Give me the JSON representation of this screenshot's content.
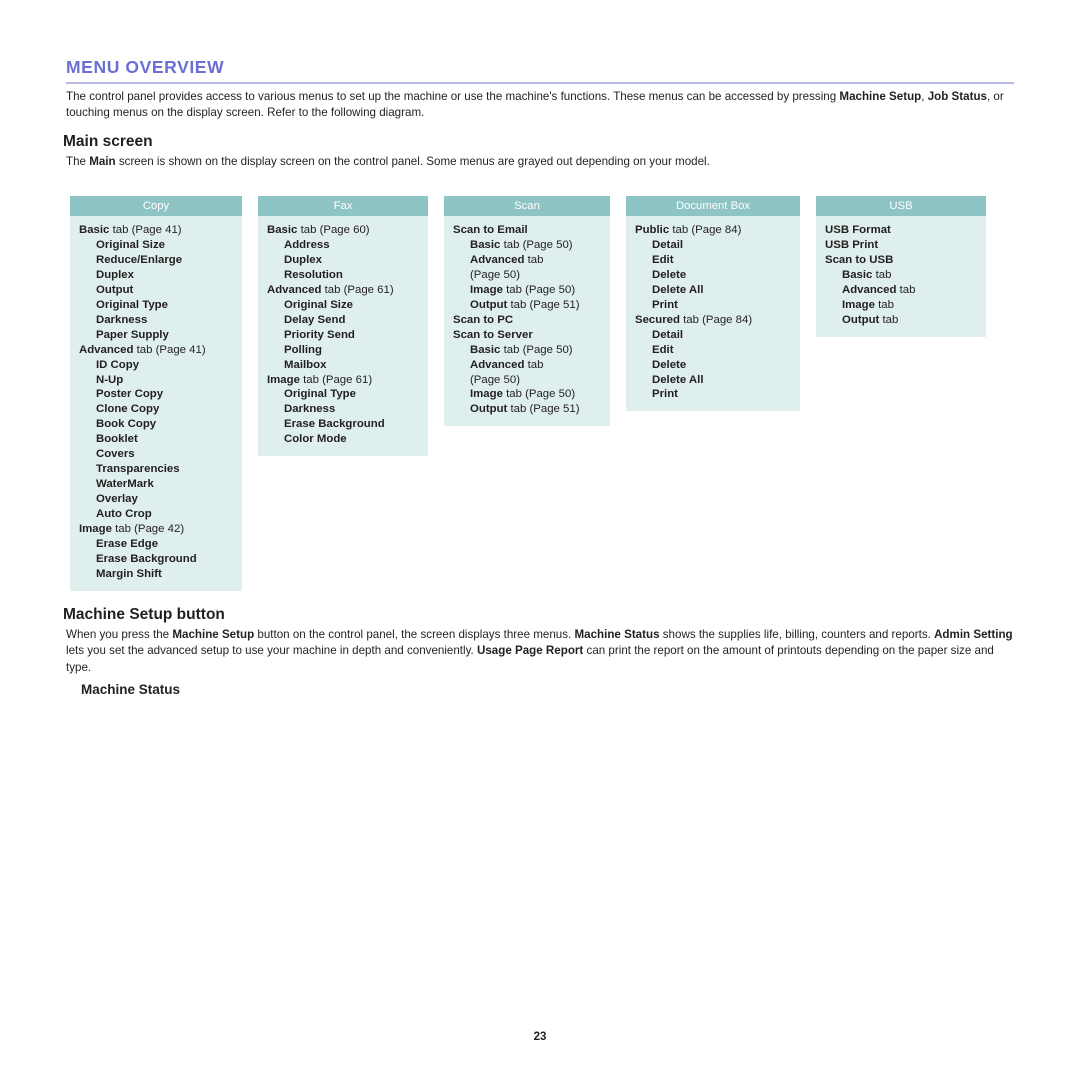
{
  "document": {
    "title": "MENU OVERVIEW",
    "page_number": "23",
    "accent_color": "#6b6fd4",
    "rule_color": "#b9bce8",
    "diagram_header_color": "#8ec4c4",
    "diagram_body_color": "#dfefee"
  },
  "intro_paragraph": {
    "full_text": "The control panel provides access to various menus to set up the machine or use the machine's functions. These menus can be accessed by pressing Machine Setup, Job Status, or touching menus on the display screen. Refer to the following diagram.",
    "segments": [
      {
        "text": "The control panel provides access to various menus to set up the machine or use the machine's functions. These menus can be accessed by pressing ",
        "bold": false
      },
      {
        "text": "Machine Setup",
        "bold": true
      },
      {
        "text": ", ",
        "bold": false
      },
      {
        "text": "Job Status",
        "bold": true
      },
      {
        "text": ", or touching menus on the display screen. Refer to the following diagram.",
        "bold": false
      }
    ]
  },
  "main_screen": {
    "heading": "Main screen",
    "paragraph": {
      "full_text": "The Main screen is shown on the display screen on the control panel. Some menus are grayed out depending on your model.",
      "segments": [
        {
          "text": "The ",
          "bold": false
        },
        {
          "text": "Main",
          "bold": true
        },
        {
          "text": " screen is shown on the display screen on the control panel. Some menus are grayed out depending on your model.",
          "bold": false
        }
      ]
    }
  },
  "diagram": {
    "columns": [
      {
        "id": "copy",
        "header": "Copy",
        "items": [
          {
            "level": 1,
            "label": "Basic",
            "suffix": " tab (Page 41)"
          },
          {
            "level": 2,
            "label": "Original Size",
            "suffix": ""
          },
          {
            "level": 2,
            "label": "Reduce/Enlarge",
            "suffix": ""
          },
          {
            "level": 2,
            "label": "Duplex",
            "suffix": ""
          },
          {
            "level": 2,
            "label": "Output",
            "suffix": ""
          },
          {
            "level": 2,
            "label": "Original Type",
            "suffix": ""
          },
          {
            "level": 2,
            "label": "Darkness",
            "suffix": ""
          },
          {
            "level": 2,
            "label": "Paper Supply",
            "suffix": ""
          },
          {
            "level": 1,
            "label": "Advanced",
            "suffix": " tab (Page 41)"
          },
          {
            "level": 2,
            "label": "ID Copy",
            "suffix": ""
          },
          {
            "level": 2,
            "label": "N-Up",
            "suffix": ""
          },
          {
            "level": 2,
            "label": "Poster Copy",
            "suffix": ""
          },
          {
            "level": 2,
            "label": "Clone Copy",
            "suffix": ""
          },
          {
            "level": 2,
            "label": "Book Copy",
            "suffix": ""
          },
          {
            "level": 2,
            "label": "Booklet",
            "suffix": ""
          },
          {
            "level": 2,
            "label": "Covers",
            "suffix": ""
          },
          {
            "level": 2,
            "label": "Transparencies",
            "suffix": ""
          },
          {
            "level": 2,
            "label": "WaterMark",
            "suffix": ""
          },
          {
            "level": 2,
            "label": "Overlay",
            "suffix": ""
          },
          {
            "level": 2,
            "label": "Auto Crop",
            "suffix": ""
          },
          {
            "level": 1,
            "label": "Image",
            "suffix": " tab (Page 42)"
          },
          {
            "level": 2,
            "label": "Erase Edge",
            "suffix": ""
          },
          {
            "level": 2,
            "label": "Erase Background",
            "suffix": ""
          },
          {
            "level": 2,
            "label": "Margin Shift",
            "suffix": ""
          }
        ]
      },
      {
        "id": "fax",
        "header": "Fax",
        "items": [
          {
            "level": 1,
            "label": "Basic",
            "suffix": " tab (Page 60)"
          },
          {
            "level": 2,
            "label": "Address",
            "suffix": ""
          },
          {
            "level": 2,
            "label": "Duplex",
            "suffix": ""
          },
          {
            "level": 2,
            "label": "Resolution",
            "suffix": ""
          },
          {
            "level": 1,
            "label": "Advanced",
            "suffix": " tab (Page 61)"
          },
          {
            "level": 2,
            "label": "Original Size",
            "suffix": ""
          },
          {
            "level": 2,
            "label": "Delay Send",
            "suffix": ""
          },
          {
            "level": 2,
            "label": "Priority Send",
            "suffix": ""
          },
          {
            "level": 2,
            "label": "Polling",
            "suffix": ""
          },
          {
            "level": 2,
            "label": "Mailbox",
            "suffix": ""
          },
          {
            "level": 1,
            "label": "Image",
            "suffix": " tab (Page 61)"
          },
          {
            "level": 2,
            "label": "Original Type",
            "suffix": ""
          },
          {
            "level": 2,
            "label": "Darkness",
            "suffix": ""
          },
          {
            "level": 2,
            "label": "Erase Background",
            "suffix": ""
          },
          {
            "level": 2,
            "label": "Color Mode",
            "suffix": ""
          }
        ]
      },
      {
        "id": "scan",
        "header": "Scan",
        "items": [
          {
            "level": 1,
            "label": "Scan to Email",
            "suffix": ""
          },
          {
            "level": 2,
            "label": "Basic",
            "suffix": " tab (Page 50)"
          },
          {
            "level": 2,
            "label": "Advanced",
            "suffix": " tab"
          },
          {
            "level": 2,
            "label": "",
            "suffix": "(Page 50)"
          },
          {
            "level": 2,
            "label": "Image",
            "suffix": " tab (Page 50)"
          },
          {
            "level": 2,
            "label": "Output",
            "suffix": " tab (Page 51)"
          },
          {
            "level": 1,
            "label": "Scan to PC",
            "suffix": ""
          },
          {
            "level": 1,
            "label": "Scan to Server",
            "suffix": ""
          },
          {
            "level": 2,
            "label": "Basic",
            "suffix": " tab (Page 50)"
          },
          {
            "level": 2,
            "label": "Advanced",
            "suffix": " tab"
          },
          {
            "level": 2,
            "label": "",
            "suffix": "(Page 50)"
          },
          {
            "level": 2,
            "label": "Image",
            "suffix": " tab (Page 50)"
          },
          {
            "level": 2,
            "label": "Output",
            "suffix": " tab (Page 51)"
          }
        ]
      },
      {
        "id": "document-box",
        "header": "Document Box",
        "items": [
          {
            "level": 1,
            "label": "Public",
            "suffix": " tab (Page 84)"
          },
          {
            "level": 2,
            "label": "Detail",
            "suffix": ""
          },
          {
            "level": 2,
            "label": "Edit",
            "suffix": ""
          },
          {
            "level": 2,
            "label": "Delete",
            "suffix": ""
          },
          {
            "level": 2,
            "label": "Delete All",
            "suffix": ""
          },
          {
            "level": 2,
            "label": "Print",
            "suffix": ""
          },
          {
            "level": 1,
            "label": "Secured",
            "suffix": " tab (Page 84)"
          },
          {
            "level": 2,
            "label": "Detail",
            "suffix": ""
          },
          {
            "level": 2,
            "label": "Edit",
            "suffix": ""
          },
          {
            "level": 2,
            "label": "Delete",
            "suffix": ""
          },
          {
            "level": 2,
            "label": "Delete All",
            "suffix": ""
          },
          {
            "level": 2,
            "label": "Print",
            "suffix": ""
          }
        ]
      },
      {
        "id": "usb",
        "header": "USB",
        "items": [
          {
            "level": 1,
            "label": "USB Format",
            "suffix": ""
          },
          {
            "level": 1,
            "label": "USB Print",
            "suffix": ""
          },
          {
            "level": 1,
            "label": "Scan to USB",
            "suffix": ""
          },
          {
            "level": 2,
            "label": "Basic",
            "suffix": " tab"
          },
          {
            "level": 2,
            "label": "Advanced",
            "suffix": " tab"
          },
          {
            "level": 2,
            "label": "Image",
            "suffix": " tab"
          },
          {
            "level": 2,
            "label": "Output",
            "suffix": " tab"
          }
        ]
      }
    ]
  },
  "machine_setup": {
    "heading": "Machine Setup button",
    "paragraph": {
      "full_text": "When you press the Machine Setup button on the control panel, the screen displays three menus. Machine Status shows the supplies life, billing, counters and reports. Admin Setting lets you set the advanced setup to use your machine in depth and conveniently. Usage Page Report can print the report on the amount of printouts depending on the paper size and type.",
      "segments": [
        {
          "text": "When you press the ",
          "bold": false
        },
        {
          "text": "Machine Setup",
          "bold": true
        },
        {
          "text": " button on the control panel, the screen displays three menus. ",
          "bold": false
        },
        {
          "text": "Machine Status",
          "bold": true
        },
        {
          "text": " shows the supplies life, billing, counters and reports. ",
          "bold": false
        },
        {
          "text": "Admin Setting",
          "bold": true
        },
        {
          "text": " lets you set the advanced setup to use your machine in depth and conveniently. ",
          "bold": false
        },
        {
          "text": "Usage Page Report",
          "bold": true
        },
        {
          "text": " can print the report on the amount of printouts depending on the paper size and type.",
          "bold": false
        }
      ]
    },
    "sub_heading": "Machine Status"
  }
}
